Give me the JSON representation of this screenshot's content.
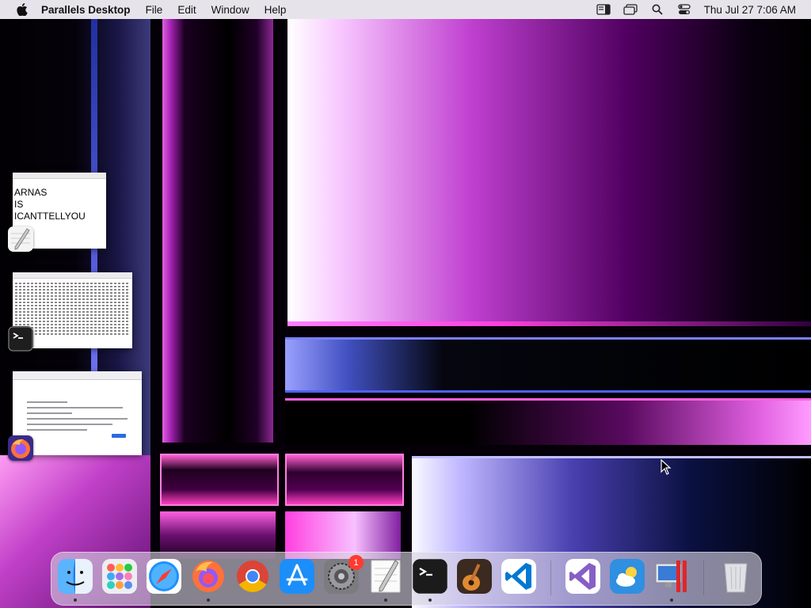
{
  "menubar": {
    "app_name": "Parallels Desktop",
    "items": [
      "File",
      "Edit",
      "Window",
      "Help"
    ],
    "clock": "Thu Jul 27  7:06 AM",
    "status_icons": [
      "sidebar-icon",
      "window-stack-icon",
      "search-icon",
      "control-center-icon"
    ]
  },
  "stage_manager": {
    "textedit_text": [
      "ARNAS",
      "IS",
      "ICANTTELLYOU"
    ],
    "apps": [
      "TextEdit",
      "Terminal",
      "Firefox"
    ]
  },
  "dock": {
    "apps": [
      "Finder",
      "Launchpad",
      "Safari",
      "Firefox",
      "Google Chrome",
      "App Store",
      "System Settings",
      "TextEdit",
      "Terminal",
      "GarageBand",
      "Visual Studio Code",
      "Visual Studio",
      "Weather",
      "Parallels Desktop",
      "Trash"
    ],
    "settings_badge": "1"
  },
  "colors": {
    "menubar_bg": "#e6e4ea",
    "wallpaper_accent": "#d040e0",
    "badge_red": "#ff3b30"
  }
}
